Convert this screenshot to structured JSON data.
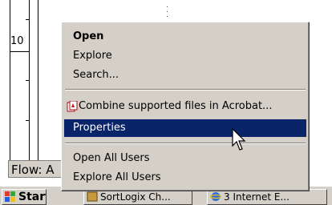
{
  "ruler": {
    "label": "10"
  },
  "flow_label": "Flow: A",
  "taskbar": {
    "start_label": "Start",
    "buttons": [
      {
        "label": "SortLogix Ch..."
      },
      {
        "label": "3 Internet E..."
      }
    ]
  },
  "context_menu": {
    "items": [
      {
        "label": "Open",
        "bold": true
      },
      {
        "label": "Explore"
      },
      {
        "label": "Search..."
      },
      {
        "label": "Combine supported files in Acrobat...",
        "icon": "acrobat-icon"
      },
      {
        "label": "Properties",
        "selected": true
      },
      {
        "label": "Open All Users"
      },
      {
        "label": "Explore All Users"
      }
    ]
  },
  "colors": {
    "menu_bg": "#d4d0c8",
    "selection_bg": "#0a246a",
    "selection_fg": "#ffffff"
  }
}
